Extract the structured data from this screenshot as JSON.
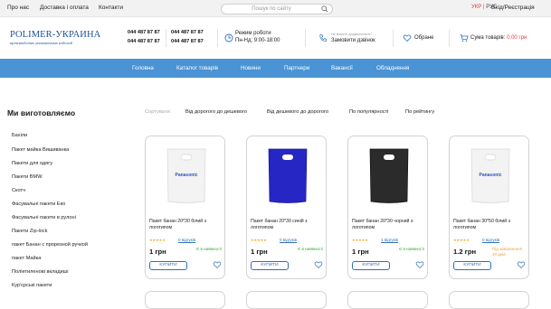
{
  "topbar": {
    "links": [
      "Про нас",
      "Доставка і оплата",
      "Контакти"
    ],
    "search_placeholder": "Пошук по сайту",
    "lang_active": "УКР",
    "lang_sep": "|",
    "lang_other": "РУС",
    "login": "Вхід/Реєстрація"
  },
  "header": {
    "logo_title": "POLIMER-УКРАИНА",
    "logo_subtitle": "производство упаковочных изделий",
    "phones": [
      "044 487 87 87",
      "044 487 87 87",
      "044 487 87 87",
      "044 487 87 87"
    ],
    "schedule_title": "Режим роботи",
    "schedule_hours": "Пн-Нд: 9:00-18:00",
    "callback_note": "Не можете додзвонитися?",
    "callback_label": "Замовити дзвінок",
    "favorites_label": "Обране",
    "cart_label": "Сума товарів:",
    "cart_sum": "0.00 грн"
  },
  "nav": [
    "Головна",
    "Каталог товарів",
    "Новини",
    "Партнери",
    "Вакансії",
    "Обладнення"
  ],
  "page_title": "Ми виготовляємо",
  "sidebar": [
    "Бахіли",
    "Пакет майка Вишиванка",
    "Пакети для одягу",
    "Пакети BMW",
    "Скотч",
    "Фасувальні пакети Еко",
    "Фасувальні пакети в рулоні",
    "Пакети Zip-lock",
    "пакет Банан с прорезной ручкой",
    "пакет Майка",
    "Поліетиленові вкладиші",
    "Кур'єрські пакети"
  ],
  "sort": {
    "label": "Сортувати:",
    "options": [
      "Від дорогого до дешевого",
      "Від дешевого до дорогого",
      "По популярності",
      "По рейтингу"
    ]
  },
  "products": [
    {
      "name": "Пакет банан 20*30 білий з логотипом",
      "stars": "★★★★★",
      "reviews": "0 відгуків",
      "availability": "Є в наявності",
      "price": "1 грн",
      "buy": "КУПИТИ",
      "bag_color": "#f3f3f3",
      "bag_text": "Panasonic"
    },
    {
      "name": "Пакет банан 20*30 синій з логотипом",
      "stars": "★★★★★",
      "reviews": "0 відгуків",
      "availability": "Є в наявності",
      "price": "1 грн",
      "buy": "КУПИТИ",
      "bag_color": "#2626c4",
      "bag_text": ""
    },
    {
      "name": "Пакет банан 20*30 чорний з логотипом",
      "stars": "★★★★★",
      "reviews": "1 відгуків",
      "availability": "Є в наявності",
      "price": "1 грн",
      "buy": "КУПИТИ",
      "bag_color": "#2b2b2b",
      "bag_text": ""
    },
    {
      "name": "Пакет банан 30*50 білий з логотипом",
      "stars": "★★★★★",
      "reviews": "0 відгуків",
      "availability": "Під замовлення 10 днів",
      "price": "1.2 грн",
      "buy": "КУПИТИ",
      "bag_color": "#f3f3f3",
      "bag_text": "Panasonic"
    }
  ],
  "colors": {
    "accent": "#4a93d4",
    "price_red": "#e63a3a",
    "logo_blue": "#1d4f9c",
    "in_stock": "#35a335",
    "on_order": "#e8a33d"
  }
}
